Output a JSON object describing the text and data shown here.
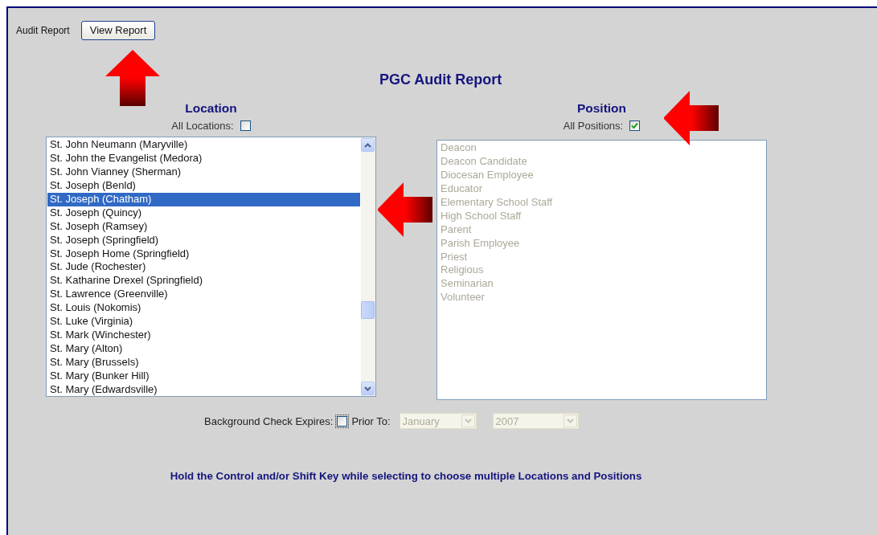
{
  "header": {
    "label": "Audit Report",
    "button": "View Report"
  },
  "title": "PGC Audit Report",
  "location": {
    "heading": "Location",
    "all_label": "All Locations:",
    "all_checked": false,
    "items": [
      {
        "text": "St. John Neumann (Maryville)",
        "selected": false
      },
      {
        "text": "St. John the Evangelist (Medora)",
        "selected": false
      },
      {
        "text": "St. John Vianney (Sherman)",
        "selected": false
      },
      {
        "text": "St. Joseph (Benld)",
        "selected": false
      },
      {
        "text": "St. Joseph (Chatham)",
        "selected": true
      },
      {
        "text": "St. Joseph (Quincy)",
        "selected": false
      },
      {
        "text": "St. Joseph (Ramsey)",
        "selected": false
      },
      {
        "text": "St. Joseph (Springfield)",
        "selected": false
      },
      {
        "text": "St. Joseph Home (Springfield)",
        "selected": false
      },
      {
        "text": "St. Jude (Rochester)",
        "selected": false
      },
      {
        "text": "St. Katharine Drexel (Springfield)",
        "selected": false
      },
      {
        "text": "St. Lawrence (Greenville)",
        "selected": false
      },
      {
        "text": "St. Louis (Nokomis)",
        "selected": false
      },
      {
        "text": "St. Luke (Virginia)",
        "selected": false
      },
      {
        "text": "St. Mark (Winchester)",
        "selected": false
      },
      {
        "text": "St. Mary (Alton)",
        "selected": false
      },
      {
        "text": "St. Mary (Brussels)",
        "selected": false
      },
      {
        "text": "St. Mary (Bunker Hill)",
        "selected": false
      },
      {
        "text": "St. Mary (Edwardsville)",
        "selected": false
      }
    ]
  },
  "position": {
    "heading": "Position",
    "all_label": "All Positions:",
    "all_checked": true,
    "disabled": true,
    "items": [
      {
        "text": "Deacon",
        "selected": false
      },
      {
        "text": "Deacon Candidate",
        "selected": false
      },
      {
        "text": "Diocesan Employee",
        "selected": false
      },
      {
        "text": "Educator",
        "selected": false
      },
      {
        "text": "Elementary School Staff",
        "selected": false
      },
      {
        "text": "High School Staff",
        "selected": false
      },
      {
        "text": "Parent",
        "selected": false
      },
      {
        "text": "Parish Employee",
        "selected": false
      },
      {
        "text": "Priest",
        "selected": false
      },
      {
        "text": "Religious",
        "selected": false
      },
      {
        "text": "Seminarian",
        "selected": false
      },
      {
        "text": "Volunteer",
        "selected": false
      }
    ]
  },
  "expires": {
    "label": "Background Check Expires:",
    "checked": false,
    "prior_label": "Prior To:",
    "month": "January",
    "year": "2007",
    "disabled": true
  },
  "hint": "Hold the Control and/or Shift Key while selecting to choose multiple Locations and Positions"
}
